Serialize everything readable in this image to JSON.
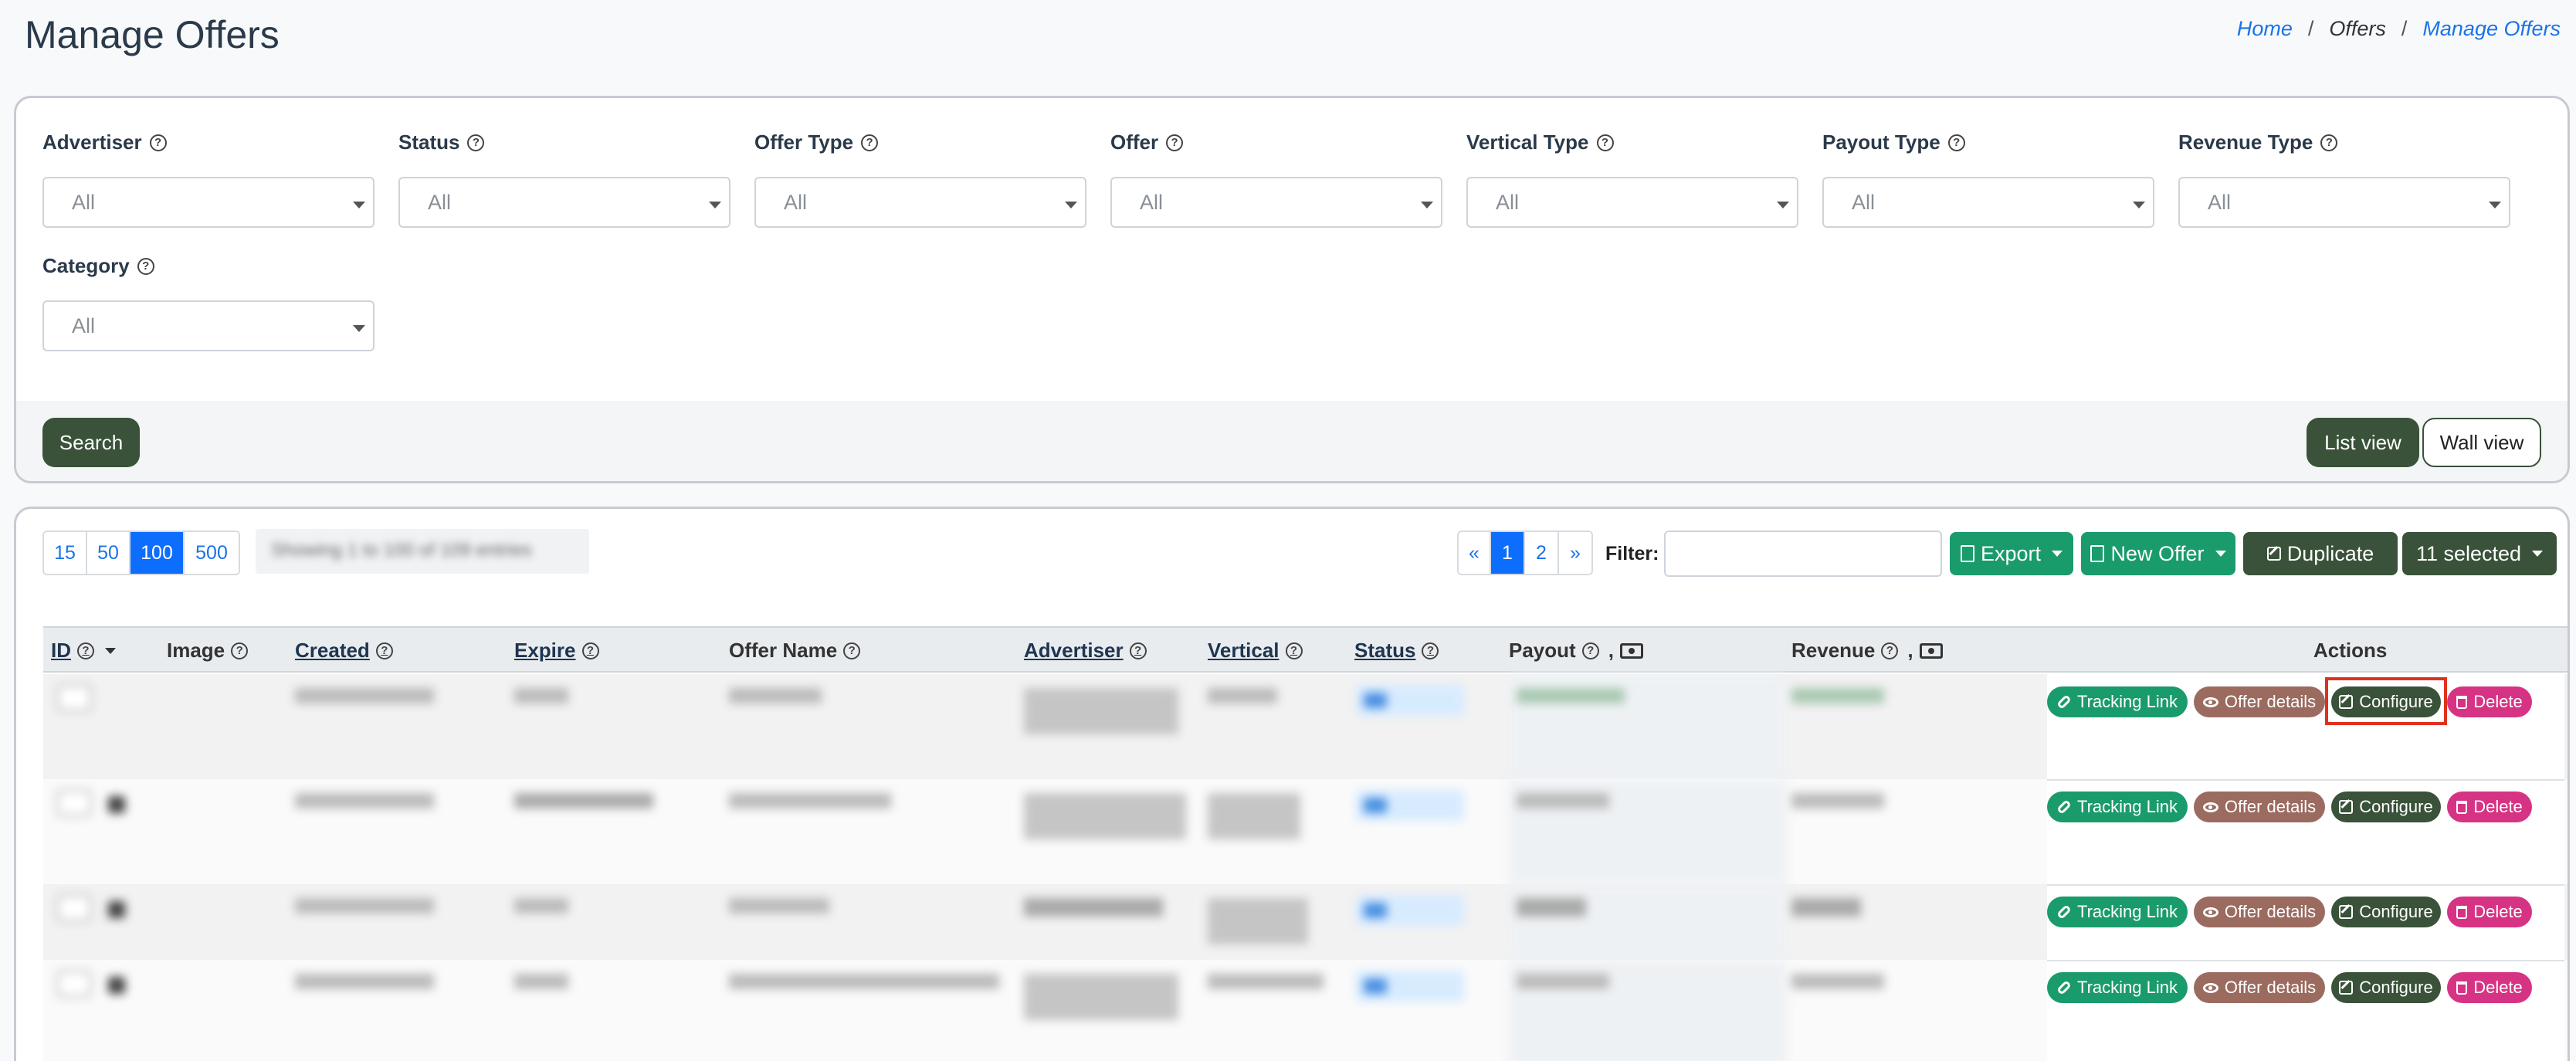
{
  "header": {
    "title": "Manage Offers",
    "breadcrumb": [
      "Home",
      "Offers",
      "Manage Offers"
    ]
  },
  "filters": {
    "fields": [
      {
        "label": "Advertiser",
        "value": "All"
      },
      {
        "label": "Status",
        "value": "All"
      },
      {
        "label": "Offer Type",
        "value": "All"
      },
      {
        "label": "Offer",
        "value": "All"
      },
      {
        "label": "Vertical Type",
        "value": "All"
      },
      {
        "label": "Payout Type",
        "value": "All"
      },
      {
        "label": "Revenue Type",
        "value": "All"
      },
      {
        "label": "Category",
        "value": "All"
      }
    ],
    "search_label": "Search",
    "list_view_label": "List view",
    "wall_view_label": "Wall view"
  },
  "toolbar": {
    "page_sizes": [
      "15",
      "50",
      "100",
      "500"
    ],
    "active_page_size": "100",
    "showing_text": "Showing 1 to 100 of 109 entries",
    "pagination": [
      "«",
      "1",
      "2",
      "»"
    ],
    "active_page": "1",
    "filter_label": "Filter:",
    "filter_value": "",
    "export_label": "Export",
    "new_offer_label": "New Offer",
    "duplicate_label": "Duplicate",
    "selected_label": "11 selected"
  },
  "table": {
    "columns": [
      "ID",
      "Image",
      "Created",
      "Expire",
      "Offer Name",
      "Advertiser",
      "Vertical",
      "Status",
      "Payout",
      "Revenue",
      "Actions"
    ],
    "action_labels": {
      "tracking": "Tracking Link",
      "details": "Offer details",
      "configure": "Configure",
      "delete": "Delete"
    }
  },
  "colors": {
    "brand_dark_green": "#395239",
    "green": "#1a9b6b",
    "details_brown": "#9b6b60",
    "delete_pink": "#d63384",
    "highlight_red": "#e0301e",
    "link_blue": "#1a73e8"
  }
}
